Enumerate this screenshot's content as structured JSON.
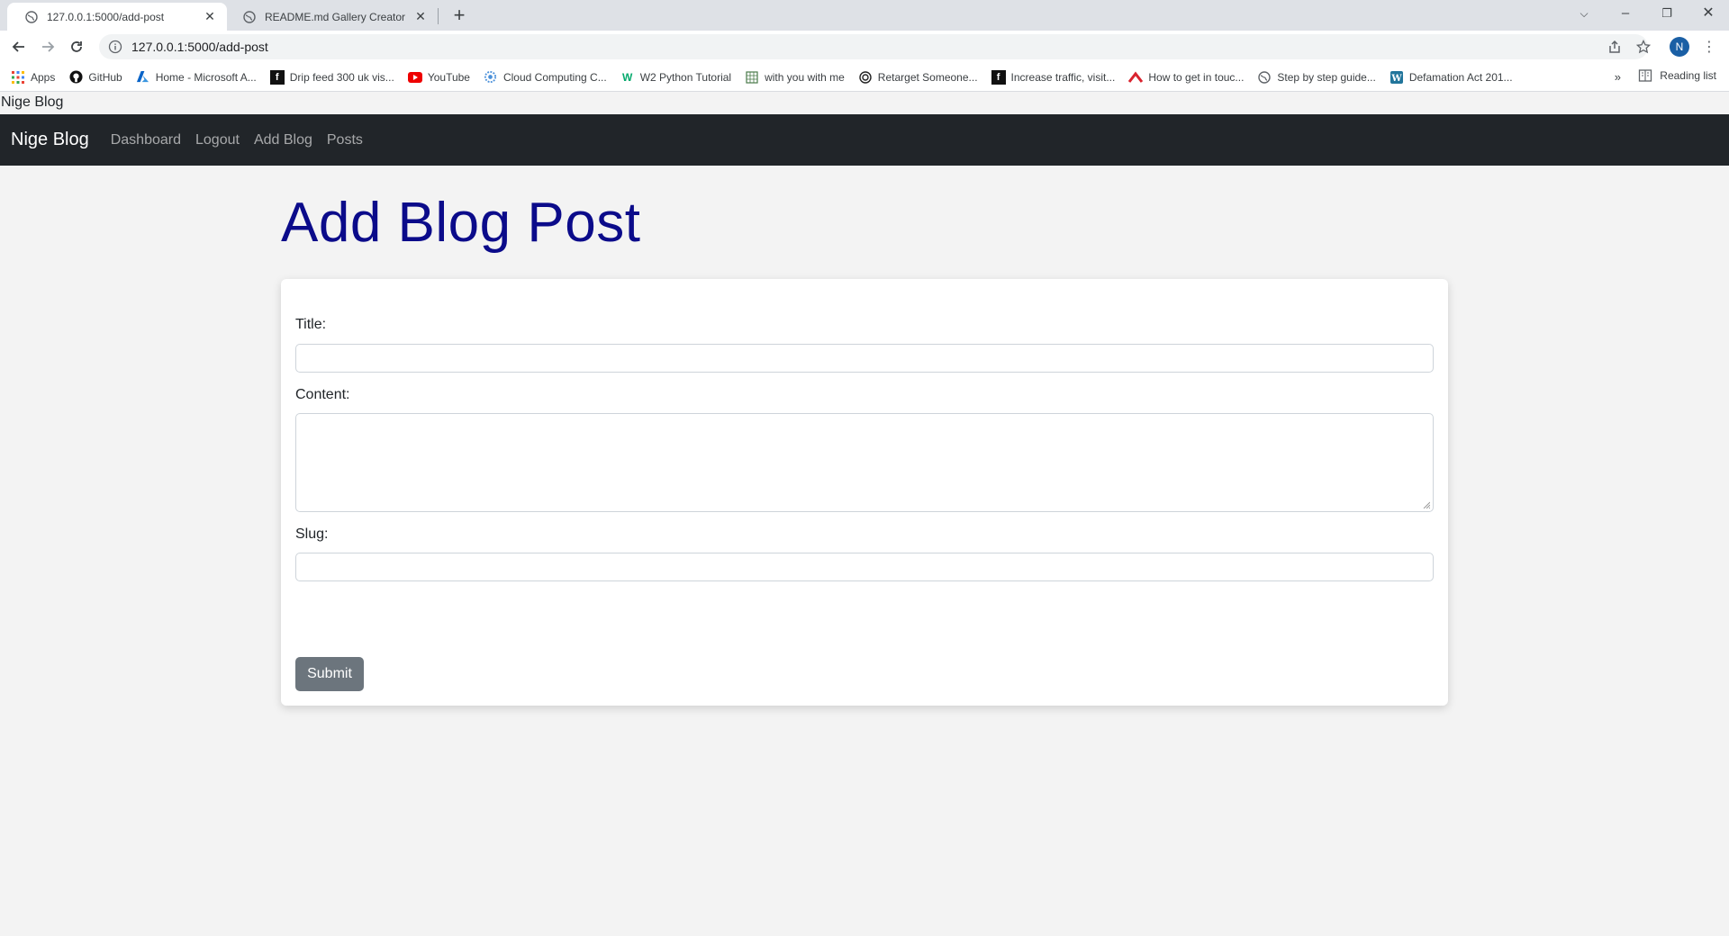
{
  "browser": {
    "tabs": [
      {
        "title": "127.0.0.1:5000/add-post",
        "active": true
      },
      {
        "title": "README.md Gallery Creator for G",
        "active": false
      }
    ],
    "url": "127.0.0.1:5000/add-post",
    "profile_initial": "N",
    "bookmarks": [
      {
        "label": "Apps",
        "icon": "apps-grid-icon"
      },
      {
        "label": "GitHub",
        "icon": "github-icon"
      },
      {
        "label": "Home - Microsoft A...",
        "icon": "azure-icon"
      },
      {
        "label": "Drip feed 300 uk vis...",
        "icon": "f-square-icon"
      },
      {
        "label": "YouTube",
        "icon": "youtube-icon"
      },
      {
        "label": "Cloud Computing C...",
        "icon": "cloud-gear-icon"
      },
      {
        "label": "W2 Python Tutorial",
        "icon": "w3-icon"
      },
      {
        "label": "with you with me",
        "icon": "grid-page-icon"
      },
      {
        "label": "Retarget Someone...",
        "icon": "target-icon"
      },
      {
        "label": "Increase traffic, visit...",
        "icon": "f-square-icon"
      },
      {
        "label": "How to get in touc...",
        "icon": "red-chevron-icon"
      },
      {
        "label": "Step by step guide...",
        "icon": "globe-icon"
      },
      {
        "label": "Defamation Act 201...",
        "icon": "wordpress-icon"
      }
    ],
    "bookmarks_more": "»",
    "reading_list": "Reading list"
  },
  "page": {
    "top_text": "Nige Blog",
    "navbar": {
      "brand": "Nige Blog",
      "links": [
        "Dashboard",
        "Logout",
        "Add Blog",
        "Posts"
      ]
    },
    "heading": "Add Blog Post",
    "form": {
      "title_label": "Title:",
      "title_value": "",
      "content_label": "Content:",
      "content_value": "",
      "slug_label": "Slug:",
      "slug_value": "",
      "submit_label": "Submit"
    }
  },
  "colors": {
    "heading": "#0b0b8a",
    "navbar_bg": "#212529",
    "submit_bg": "#6c757d",
    "page_bg": "#f3f3f3"
  }
}
